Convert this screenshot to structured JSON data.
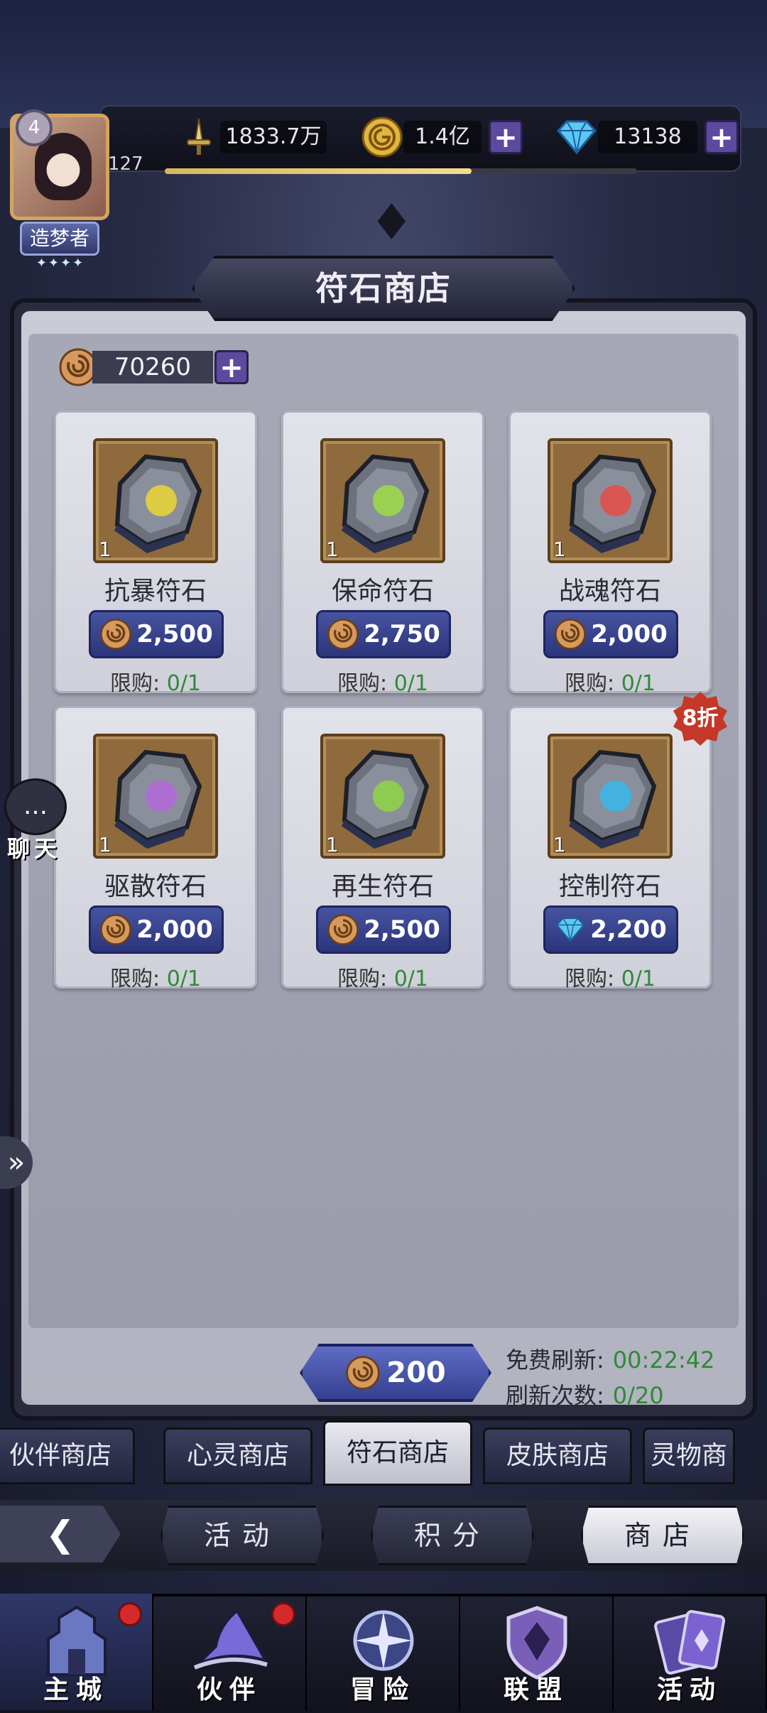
{
  "player": {
    "level": "4",
    "xp_level_number": "127",
    "rank_title": "造梦者",
    "rank_stars": "✦✦✦✦",
    "xp_progress": 0.65
  },
  "resources": {
    "power": "1833.7万",
    "gold": "1.4亿",
    "diamonds": "13138"
  },
  "shop": {
    "title": "符石商店",
    "rune_currency": "70260",
    "items": [
      {
        "name": "抗暴符石",
        "qty": "1",
        "price": "2,500",
        "currency": "rune-coin",
        "limit_label": "限购:",
        "limit_value": "0/1",
        "glyph_color": "#e5d23a",
        "discount": ""
      },
      {
        "name": "保命符石",
        "qty": "1",
        "price": "2,750",
        "currency": "rune-coin",
        "limit_label": "限购:",
        "limit_value": "0/1",
        "glyph_color": "#9bd84a",
        "discount": ""
      },
      {
        "name": "战魂符石",
        "qty": "1",
        "price": "2,000",
        "currency": "rune-coin",
        "limit_label": "限购:",
        "limit_value": "0/1",
        "glyph_color": "#e0504a",
        "discount": ""
      },
      {
        "name": "驱散符石",
        "qty": "1",
        "price": "2,000",
        "currency": "rune-coin",
        "limit_label": "限购:",
        "limit_value": "0/1",
        "glyph_color": "#b06ad8",
        "discount": ""
      },
      {
        "name": "再生符石",
        "qty": "1",
        "price": "2,500",
        "currency": "rune-coin",
        "limit_label": "限购:",
        "limit_value": "0/1",
        "glyph_color": "#8ed24a",
        "discount": ""
      },
      {
        "name": "控制符石",
        "qty": "1",
        "price": "2,200",
        "currency": "diamond",
        "limit_label": "限购:",
        "limit_value": "0/1",
        "glyph_color": "#3cb6e8",
        "discount": "8折"
      }
    ],
    "refresh_cost": "200",
    "free_refresh_label": "免费刷新:",
    "free_refresh_timer": "00:22:42",
    "refresh_count_label": "刷新次数:",
    "refresh_count": "0/20"
  },
  "shop_tabs": [
    "伙伴商店",
    "心灵商店",
    "符石商店",
    "皮肤商店",
    "灵物商"
  ],
  "sub_nav": [
    "活动",
    "积分",
    "商店"
  ],
  "bottom_nav": [
    "主城",
    "伙伴",
    "冒险",
    "联盟",
    "活动"
  ],
  "chat_label": "聊天",
  "colors": {
    "price_button": "#3a4590",
    "limit_value": "#2e8a36",
    "sale_badge": "#c43828"
  }
}
